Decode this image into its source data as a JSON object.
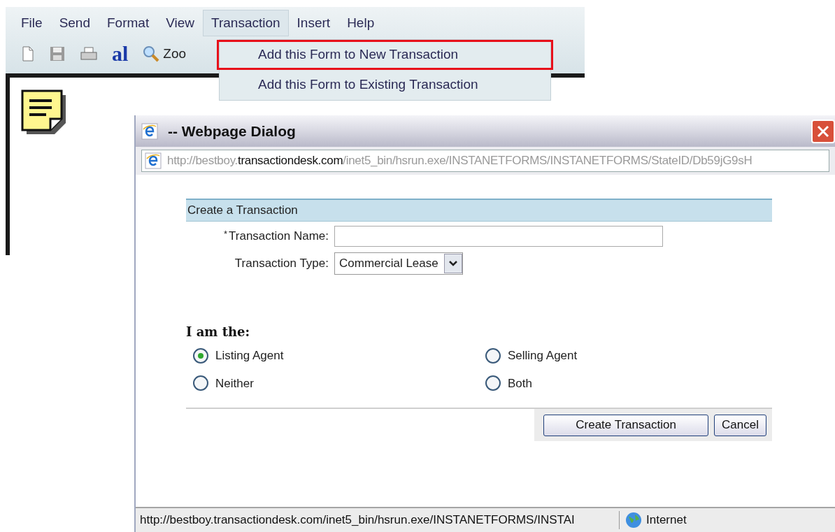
{
  "app": {
    "menu": [
      {
        "label": "File",
        "selected": false
      },
      {
        "label": "Send",
        "selected": false
      },
      {
        "label": "Format",
        "selected": false
      },
      {
        "label": "View",
        "selected": false
      },
      {
        "label": "Transaction",
        "selected": true
      },
      {
        "label": "Insert",
        "selected": false
      },
      {
        "label": "Help",
        "selected": false
      }
    ],
    "toolbar": [
      {
        "kind": "new"
      },
      {
        "kind": "save"
      },
      {
        "kind": "print"
      },
      {
        "kind": "font",
        "text": "al"
      },
      {
        "kind": "zoom",
        "text": "Zoo"
      }
    ],
    "dropdown": [
      {
        "label": "Add this Form to New Transaction",
        "selected": true
      },
      {
        "label": "Add this Form to Existing Transaction",
        "selected": false
      }
    ]
  },
  "dialog": {
    "title": "-- Webpage Dialog",
    "address": [
      {
        "text": "http://bestboy.",
        "emphasis": false
      },
      {
        "text": "transactiondesk.com",
        "emphasis": true
      },
      {
        "text": "/inet5_bin/hsrun.exe/INSTANETFORMS/INSTANETFORMS/StateID/Db59jG9sH",
        "emphasis": false
      }
    ],
    "panel_title": "Create a Transaction",
    "fields": [
      {
        "kind": "text",
        "required_mark": "*",
        "label": "Transaction Name:"
      },
      {
        "kind": "select",
        "label": "Transaction Type:",
        "value": "Commercial Lease"
      }
    ],
    "role_heading": "I am the:",
    "roles": [
      {
        "label": "Listing Agent",
        "selected": true
      },
      {
        "label": "Selling Agent",
        "selected": false
      },
      {
        "label": "Neither",
        "selected": false
      },
      {
        "label": "Both",
        "selected": false
      }
    ],
    "buttons": [
      "Create Transaction",
      "Cancel"
    ],
    "status_bar": {
      "url": "http://bestboy.transactiondesk.com/inet5_bin/hsrun.exe/INSTANETFORMS/INSTAI",
      "zone": "Internet"
    }
  }
}
